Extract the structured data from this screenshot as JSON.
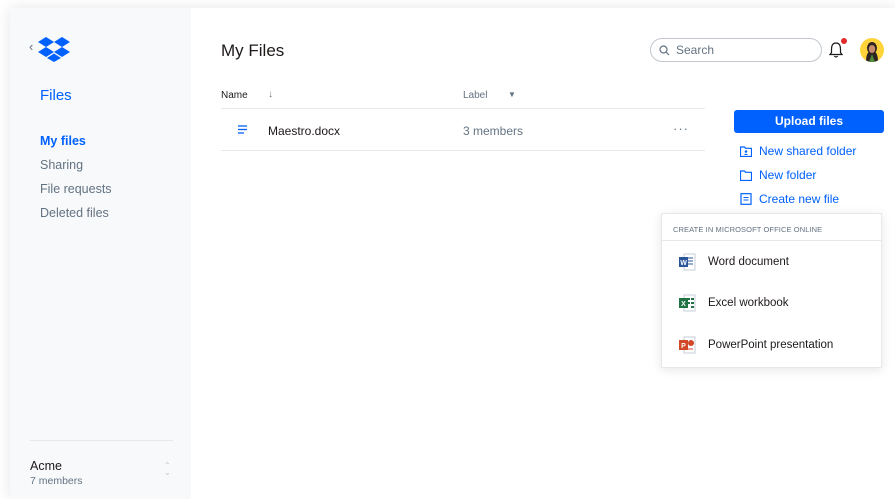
{
  "sidebar": {
    "title": "Files",
    "items": [
      {
        "label": "My files",
        "active": true
      },
      {
        "label": "Sharing"
      },
      {
        "label": "File requests"
      },
      {
        "label": "Deleted files"
      }
    ],
    "team": {
      "name": "Acme",
      "members": "7 members"
    }
  },
  "header": {
    "title": "My Files",
    "search_placeholder": "Search"
  },
  "table": {
    "columns": {
      "name": "Name",
      "label": "Label"
    },
    "rows": [
      {
        "name": "Maestro.docx",
        "label": "3 members"
      }
    ]
  },
  "actions": {
    "upload": "Upload files",
    "new_shared_folder": "New shared folder",
    "new_folder": "New folder",
    "create_new_file": "Create new file"
  },
  "office_menu": {
    "header": "CREATE IN MICROSOFT OFFICE ONLINE",
    "items": [
      {
        "label": "Word document",
        "icon": "word-icon"
      },
      {
        "label": "Excel workbook",
        "icon": "excel-icon"
      },
      {
        "label": "PowerPoint presentation",
        "icon": "powerpoint-icon"
      }
    ]
  },
  "colors": {
    "accent": "#0061fe",
    "word": "#2b579a",
    "excel": "#217346",
    "powerpoint": "#d24726",
    "notification": "#e02b2b"
  }
}
